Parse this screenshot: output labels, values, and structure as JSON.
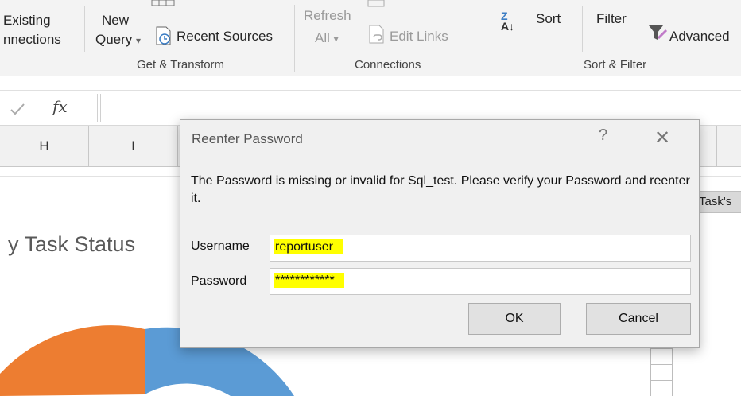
{
  "ribbon": {
    "get_data": {
      "existing_connections_line1": "Existing",
      "existing_connections_line2": "nnections",
      "new_query_line1": "New",
      "new_query_line2": "Query",
      "recent_sources": "Recent Sources",
      "group_label": "Get & Transform"
    },
    "connections": {
      "refresh_all_line1": "Refresh",
      "refresh_all_line2": "All",
      "edit_links": "Edit Links",
      "group_label": "Connections"
    },
    "sort_filter": {
      "sort": "Sort",
      "filter": "Filter",
      "advanced": "Advanced",
      "group_label": "Sort & Filter"
    }
  },
  "formula_bar": {
    "fx_label": "fx",
    "value": ""
  },
  "columns": [
    "H",
    "I"
  ],
  "sheet": {
    "chart_title_partial": "y Task Status",
    "cell_label_partial": "Task's"
  },
  "dialog": {
    "title": "Reenter Password",
    "help": "?",
    "close": "✕",
    "message": "The Password is missing or invalid for Sql_test.  Please verify your Password and reenter it.",
    "username_label": "Username",
    "username_value": "reportuser",
    "password_label": "Password",
    "password_value": "************",
    "ok_label": "OK",
    "cancel_label": "Cancel"
  },
  "colors": {
    "donut_orange": "#ED7D31",
    "donut_blue": "#5B9BD5",
    "highlight": "#FFFF00"
  }
}
